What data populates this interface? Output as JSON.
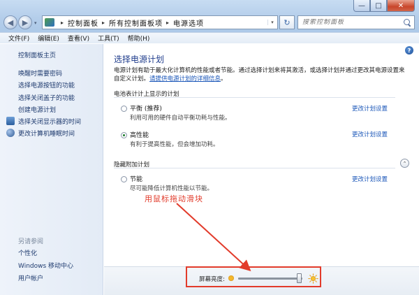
{
  "window": {
    "minimize": "—",
    "maximize": "□",
    "close": "✕"
  },
  "nav": {
    "back": "◀",
    "forward": "▶",
    "dropdown": "▾",
    "refresh": "↻"
  },
  "address": {
    "crumbs": [
      "控制面板",
      "所有控制面板项",
      "电源选项"
    ],
    "separator": "▸"
  },
  "search": {
    "placeholder": "搜索控制面板"
  },
  "menu": [
    "文件(F)",
    "编辑(E)",
    "查看(V)",
    "工具(T)",
    "帮助(H)"
  ],
  "sidebar": {
    "home": "控制面板主页",
    "items": [
      "唤醒时需要密码",
      "选择电源按钮的功能",
      "选择关闭盖子的功能",
      "创建电源计划",
      "选择关闭显示器的时间",
      "更改计算机睡眠时间"
    ],
    "see_also_title": "另请参阅",
    "see_also": [
      "个性化",
      "Windows 移动中心",
      "用户帐户"
    ]
  },
  "main": {
    "help": "?",
    "heading": "选择电源计划",
    "description": "电源计划有助于最大化计算机的性能或者节能。通过选择计划来将其激活，或选择计划并通过更改其电源设置来自定义计划。",
    "description_link": "请提供电源计划的详细信息",
    "group_battery": "电池表计计上显示的计划",
    "group_hidden": "隐藏附加计划",
    "plans": [
      {
        "name": "平衡 (推荐)",
        "desc": "利用可用的硬件自动平衡功耗与性能。",
        "link": "更改计划设置",
        "selected": false
      },
      {
        "name": "高性能",
        "desc": "有利于提高性能，但会增加功耗。",
        "link": "更改计划设置",
        "selected": true
      },
      {
        "name": "节能",
        "desc": "尽可能降低计算机性能以节能。",
        "link": "更改计划设置",
        "selected": false
      }
    ],
    "collapse": "⌃",
    "annotation": "用鼠标拖动滑块"
  },
  "brightness": {
    "label": "屏幕亮度:",
    "level": 0.95
  },
  "colors": {
    "annotation_red": "#e23b2b",
    "link_blue": "#1a56b8",
    "heading_blue": "#1f3c8c"
  },
  "icons": {
    "address": "control-panel-icon",
    "search": "search-icon",
    "help": "help-icon",
    "sidebar_monitor": "monitor-icon",
    "sidebar_sleep": "moon-icon",
    "sun_small": "sun-small-icon",
    "sun_big": "sun-large-icon"
  }
}
